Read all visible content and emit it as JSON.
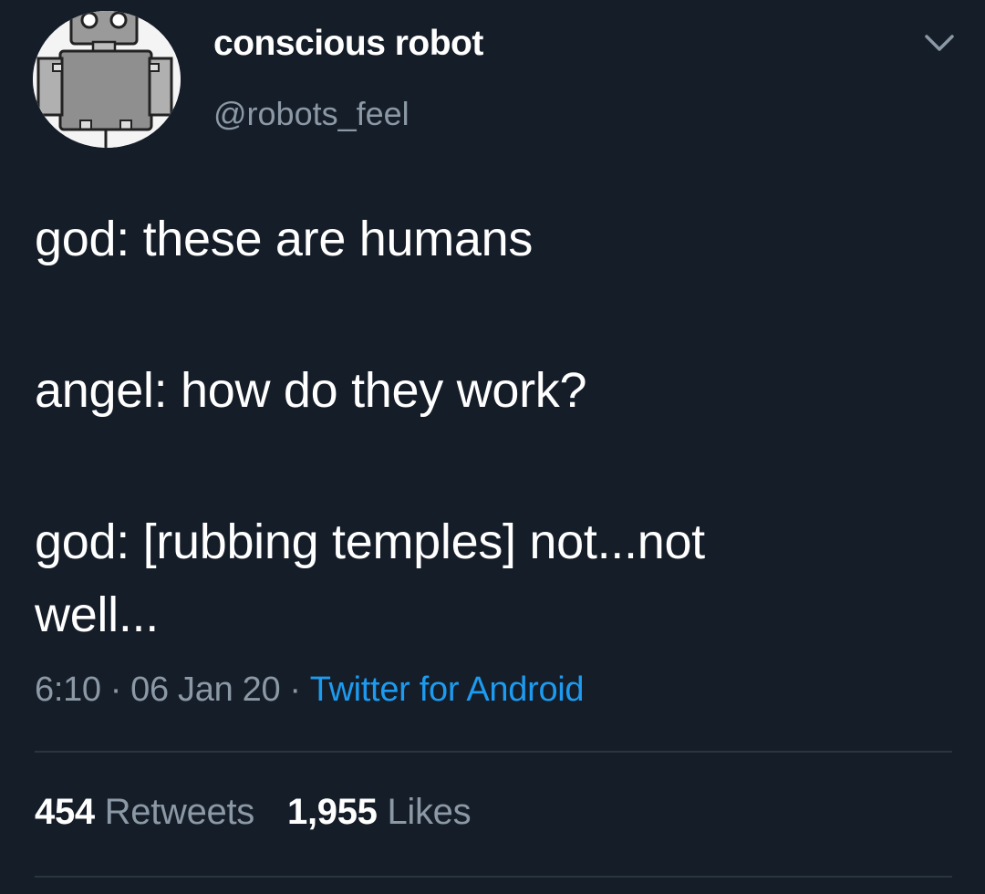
{
  "user": {
    "display_name": "conscious robot",
    "handle": "@robots_feel",
    "avatar_icon": "robot-avatar"
  },
  "menu_icon": "chevron-down-icon",
  "tweet": {
    "lines": [
      "god: these are humans",
      "angel: how do they work?",
      "god: [rubbing temples] not...not",
      "well..."
    ]
  },
  "meta": {
    "time": "6:10",
    "separator": "·",
    "date": "06 Jan 20",
    "source": "Twitter for Android"
  },
  "stats": {
    "retweets_count": "454",
    "retweets_label": "Retweets",
    "likes_count": "1,955",
    "likes_label": "Likes"
  },
  "colors": {
    "background": "#151d28",
    "text": "#ffffff",
    "muted": "#8b98a5",
    "link": "#1d9bf0",
    "divider": "#2a3542"
  }
}
